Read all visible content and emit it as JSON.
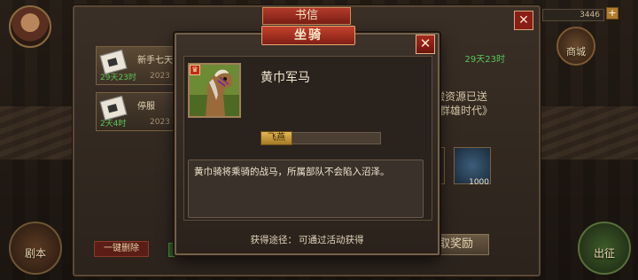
{
  "background": {
    "resource_value": "3446",
    "shop_label": "商城",
    "left_round_label": "剧本",
    "right_round_label": "出征"
  },
  "mail_window": {
    "title": "书信",
    "close_glyph": "✕",
    "items": [
      {
        "name": "新手七天",
        "date": "2023",
        "days": "29天23时"
      },
      {
        "name": "停服",
        "date": "2023",
        "days": "2天4时"
      }
    ],
    "right_days": "29天23时",
    "right_text_1": "补偿资源已送",
    "right_text_2": "《群雄时代》",
    "reward_count": "1000",
    "delete_all_label": "一键删除",
    "claim_label": "领取奖励"
  },
  "dialog": {
    "title": "坐骑",
    "close_glyph": "✕",
    "mount_name": "黄巾军马",
    "rank_glyph": "♛",
    "level_tag": "飞燕",
    "level_progress": 0.0,
    "description": "黄巾骑将乘骑的战马，所属部队不会陷入沼泽。",
    "source_label": "获得途径：",
    "source_value": "可通过活动获得"
  }
}
